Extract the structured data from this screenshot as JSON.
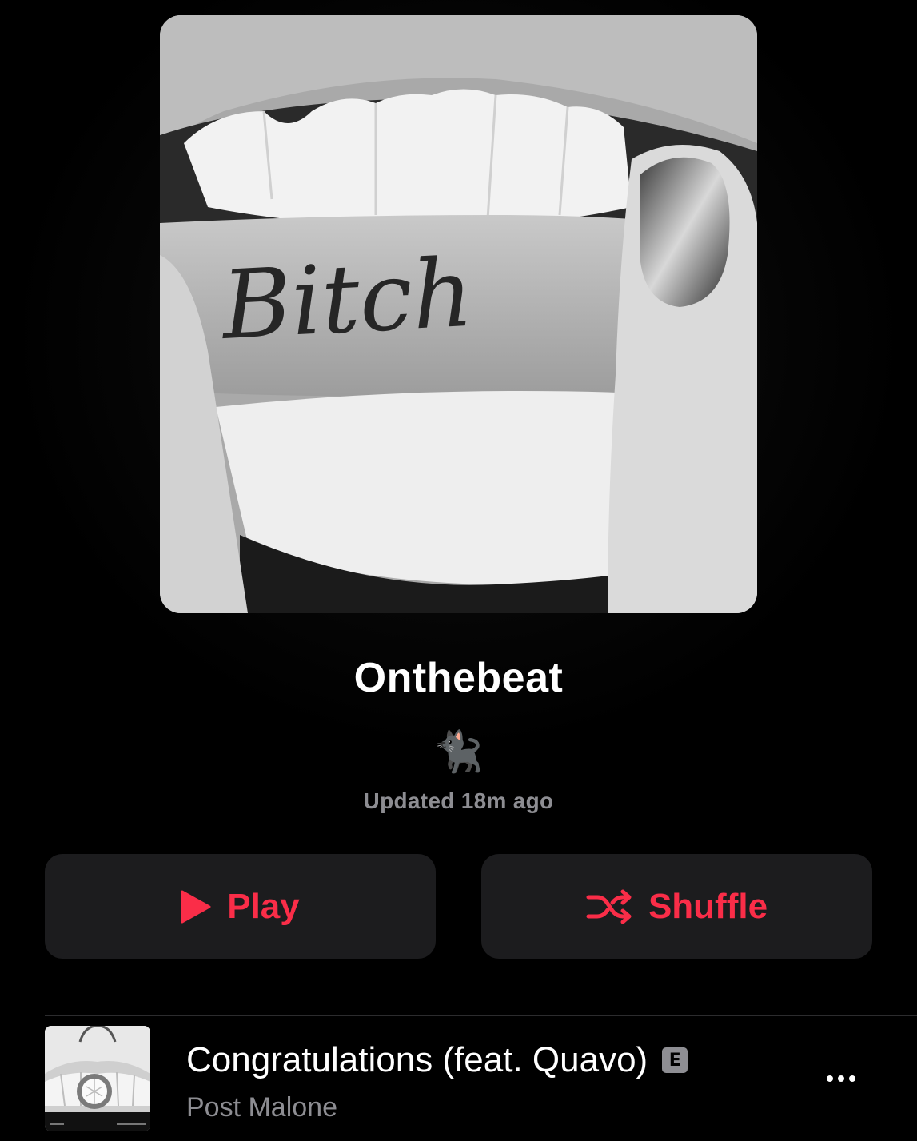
{
  "playlist": {
    "title": "Onthebeat",
    "description": "🐈‍⬛",
    "updated": "Updated 18m ago",
    "artwork_text": "Bitch"
  },
  "actions": {
    "play_label": "Play",
    "shuffle_label": "Shuffle"
  },
  "tracks": [
    {
      "title": "Congratulations (feat. Quavo)",
      "explicit_badge": "E",
      "artist": "Post Malone"
    }
  ],
  "icons": {
    "play": "play-icon",
    "shuffle": "shuffle-icon",
    "more": "more-icon"
  },
  "colors": {
    "accent": "#fa2d48",
    "button_bg": "#1c1c1e",
    "secondary_text": "#8d8d92",
    "background": "#000000"
  }
}
